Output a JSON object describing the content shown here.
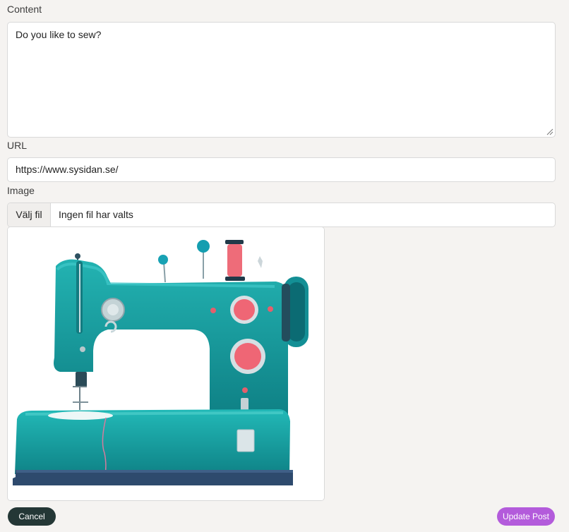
{
  "form": {
    "content_label": "Content",
    "content_value": "Do you like to sew?",
    "url_label": "URL",
    "url_value": "https://www.sysidan.se/",
    "image_label": "Image",
    "file_button_label": "Välj fil",
    "file_status": "Ingen fil har valts"
  },
  "image": {
    "subject": "sewing-machine-illustration"
  },
  "actions": {
    "cancel_label": "Cancel",
    "update_label": "Update Post"
  },
  "colors": {
    "background": "#f5f3f1",
    "primary_dark": "#243736",
    "accent_purple": "#b35bdb",
    "teal": "#159c9b",
    "coral": "#f06777"
  }
}
